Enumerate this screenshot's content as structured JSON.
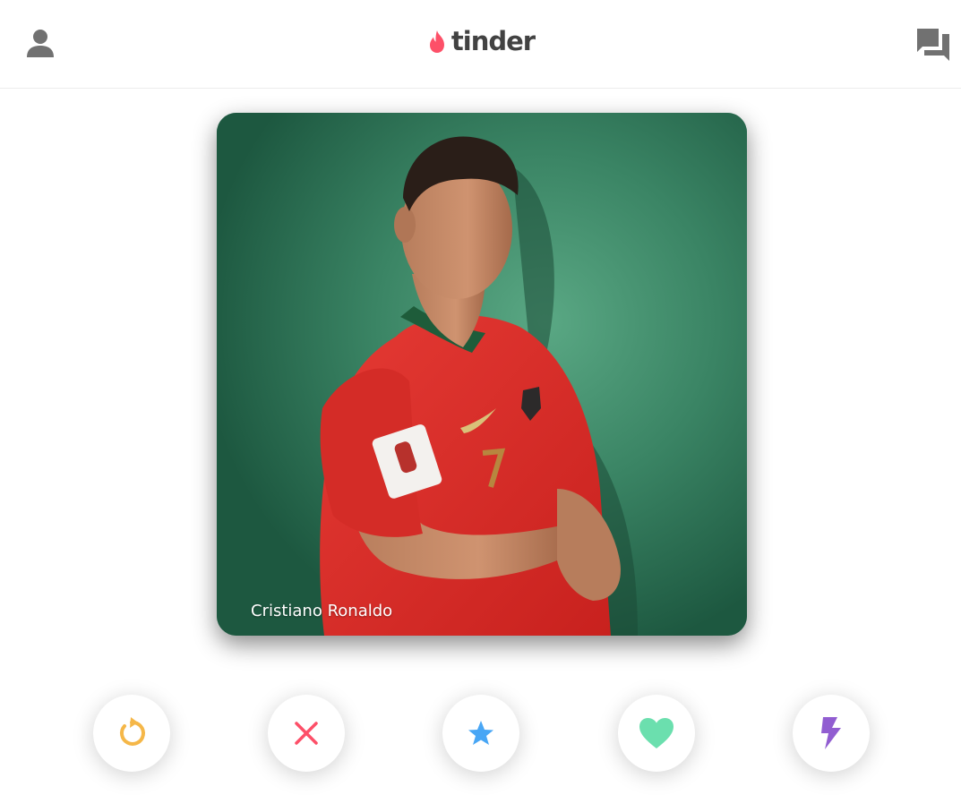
{
  "app": {
    "logo_text": "tinder",
    "brand_color": "#fd5068"
  },
  "header": {
    "profile_icon": "person-icon",
    "messages_icon": "chat-bubbles-icon",
    "icon_color": "#717171"
  },
  "card": {
    "name": "Cristiano Ronaldo",
    "photo": "portrait-photo"
  },
  "actions": [
    {
      "name": "rewind",
      "icon": "rewind-icon",
      "color": "#f5b748"
    },
    {
      "name": "nope",
      "icon": "close-icon",
      "color": "#fd4f68"
    },
    {
      "name": "super-like",
      "icon": "star-icon",
      "color": "#48a6f5"
    },
    {
      "name": "like",
      "icon": "heart-icon",
      "color": "#6bdfae"
    },
    {
      "name": "boost",
      "icon": "lightning-icon",
      "color": "#915dd1"
    }
  ]
}
